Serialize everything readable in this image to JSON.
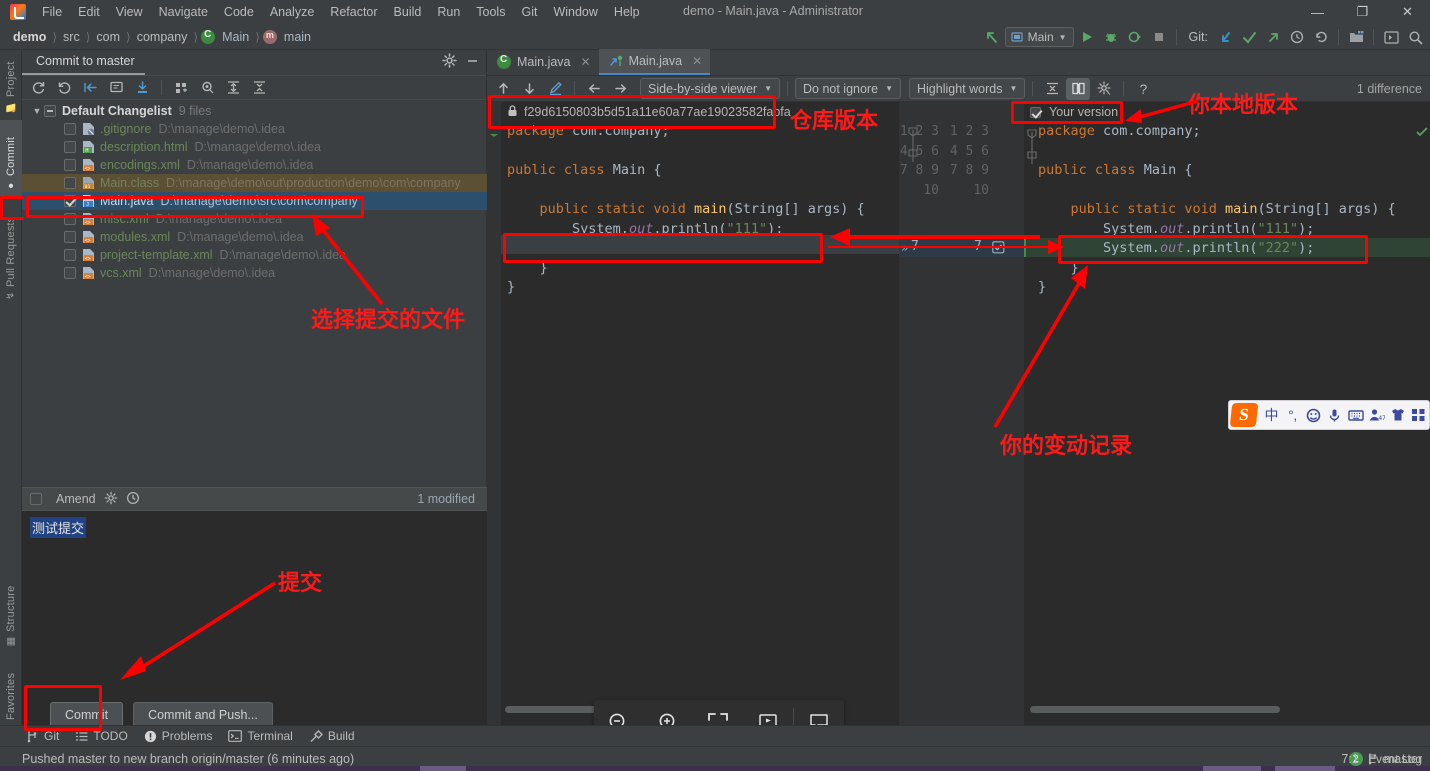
{
  "window": {
    "title": "demo - Main.java - Administrator",
    "controls": {
      "minimize": "—",
      "maximize": "❐",
      "close": "✕"
    }
  },
  "menubar": {
    "items": [
      "File",
      "Edit",
      "View",
      "Navigate",
      "Code",
      "Analyze",
      "Refactor",
      "Build",
      "Run",
      "Tools",
      "Git",
      "Window",
      "Help"
    ]
  },
  "breadcrumb": {
    "items": [
      "demo",
      "src",
      "com",
      "company",
      "Main",
      "main"
    ],
    "separator": "❯"
  },
  "toolbar_right": {
    "run_config": "Main",
    "git_label": "Git:",
    "icons": [
      "back-arrow-icon",
      "run-icon",
      "debug-icon",
      "coverage-icon",
      "stop-icon",
      "update-project-icon",
      "commit-icon",
      "push-icon",
      "history-icon",
      "rollback-icon",
      "project-structure-icon",
      "terminal-icon",
      "search-everywhere-icon"
    ]
  },
  "left_tool_strip": {
    "top_tabs": [
      {
        "label": "Project",
        "icon": "folder-icon",
        "selected": false
      },
      {
        "label": "Commit",
        "icon": "commit-icon",
        "selected": true
      },
      {
        "label": "Pull Requests",
        "icon": "pull-request-icon",
        "selected": false
      }
    ],
    "bottom_tabs": [
      {
        "label": "Structure",
        "icon": "structure-icon",
        "selected": false
      },
      {
        "label": "Favorites",
        "icon": "star-icon",
        "selected": false
      }
    ]
  },
  "commit_window": {
    "title": "Commit to master",
    "header_icons": [
      "gear-icon",
      "minimize-icon"
    ],
    "toolbar_icons": [
      "refresh-icon",
      "rollback-icon",
      "shelve-icon",
      "diff-icon",
      "download-icon",
      "group-by-icon",
      "preview-icon",
      "expand-all-icon",
      "collapse-all-icon"
    ],
    "changelist": {
      "name": "Default Changelist",
      "count": "9 files",
      "checkbox": "partial"
    },
    "files": [
      {
        "name": ".gitignore",
        "path": "D:\\manage\\demo\\.idea",
        "checked": false,
        "state": "normal",
        "icon": "gitignore-file-icon"
      },
      {
        "name": "description.html",
        "path": "D:\\manage\\demo\\.idea",
        "checked": false,
        "state": "normal",
        "icon": "html-file-icon"
      },
      {
        "name": "encodings.xml",
        "path": "D:\\manage\\demo\\.idea",
        "checked": false,
        "state": "normal",
        "icon": "xml-file-icon"
      },
      {
        "name": "Main.class",
        "path": "D:\\manage\\demo\\out\\production\\demo\\com\\company",
        "checked": false,
        "state": "ignored",
        "icon": "class-file-icon"
      },
      {
        "name": "Main.java",
        "path": "D:\\manage\\demo\\src\\com\\company",
        "checked": true,
        "state": "selected",
        "icon": "java-file-icon"
      },
      {
        "name": "misc.xml",
        "path": "D:\\manage\\demo\\.idea",
        "checked": false,
        "state": "normal",
        "icon": "xml-file-icon"
      },
      {
        "name": "modules.xml",
        "path": "D:\\manage\\demo\\.idea",
        "checked": false,
        "state": "normal",
        "icon": "xml-file-icon"
      },
      {
        "name": "project-template.xml",
        "path": "D:\\manage\\demo\\.idea",
        "checked": false,
        "state": "normal",
        "icon": "xml-file-icon"
      },
      {
        "name": "vcs.xml",
        "path": "D:\\manage\\demo\\.idea",
        "checked": false,
        "state": "normal",
        "icon": "xml-file-icon"
      }
    ],
    "amend_label": "Amend",
    "modified_label": "1 modified",
    "commit_message": "测试提交",
    "buttons": {
      "commit": "Commit",
      "commit_and_push": "Commit and Push..."
    }
  },
  "editor_tabs": [
    {
      "label": "Main.java",
      "icon": "java-class-icon",
      "active": false
    },
    {
      "label": "Main.java",
      "icon": "diff-icon",
      "active": true
    }
  ],
  "diff_toolbar": {
    "nav_icons": [
      "previous-difference-icon",
      "next-difference-icon",
      "edit-source-icon",
      "accept-left-icon",
      "accept-right-icon"
    ],
    "viewer_mode": "Side-by-side viewer",
    "ignore_policy": "Do not ignore",
    "highlight_policy": "Highlight words",
    "right_icons": [
      "collapse-unchanged-icon",
      "synchronize-scrolling-icon",
      "settings-icon",
      "help-icon"
    ],
    "difference_count": "1 difference"
  },
  "diff": {
    "left_title": "f29d6150803b5d51a11e60a77ae19023582fabfa",
    "left_title_icon": "lock-icon",
    "right_title": "Your version",
    "right_title_checkbox": true,
    "left_lines": [
      "package com.company;",
      "",
      "public class Main {",
      "",
      "    public static void main(String[] args) {",
      "        System.out.println(\"111\");",
      "",
      "    }",
      "}"
    ],
    "right_lines": [
      "package com.company;",
      "",
      "public class Main {",
      "",
      "    public static void main(String[] args) {",
      "        System.out.println(\"111\");",
      "        System.out.println(\"222\");",
      "    }",
      "}"
    ],
    "left_line_numbers": [
      "1",
      "2",
      "3",
      "4",
      "5",
      "6",
      "7",
      "8",
      "9",
      "10"
    ],
    "right_line_numbers": [
      "1",
      "2",
      "3",
      "4",
      "5",
      "6",
      "7",
      "8",
      "9",
      "10"
    ],
    "changed_line": "7"
  },
  "float_toolbar": {
    "buttons": [
      "zoom-out-icon",
      "zoom-in-icon",
      "fit-content-icon",
      "presentation-mode-icon",
      "comment-icon"
    ]
  },
  "bottom_bar": {
    "items": [
      {
        "label": "Git",
        "icon": "git-branch-icon"
      },
      {
        "label": "TODO",
        "icon": "todo-icon"
      },
      {
        "label": "Problems",
        "icon": "problems-icon"
      },
      {
        "label": "Terminal",
        "icon": "terminal-icon"
      },
      {
        "label": "Build",
        "icon": "build-hammer-icon"
      }
    ]
  },
  "status_bar": {
    "message": "Pushed master to new branch origin/master (6 minutes ago)",
    "event_log": "Event Log",
    "event_count": "2",
    "caret_position": "7:1",
    "branch": "master"
  },
  "ime_bar": {
    "logo": "S",
    "buttons": [
      "中",
      "°‚",
      "smiley-icon",
      "mic-icon",
      "keyboard-icon",
      "user-icon",
      "skin-icon",
      "apps-icon"
    ]
  },
  "annotations": [
    {
      "id": "repo-version",
      "text": "仓库版本"
    },
    {
      "id": "your-local-version",
      "text": "你本地版本"
    },
    {
      "id": "select-files-to-commit",
      "text": "选择提交的文件"
    },
    {
      "id": "your-change-record",
      "text": "你的变动记录"
    },
    {
      "id": "commit-action",
      "text": "提交"
    }
  ],
  "colors": {
    "accent_blue": "#4a88c7",
    "annotation_red": "#ff0000",
    "green_file": "#6a8759",
    "selection_blue": "#2d4f6e"
  }
}
